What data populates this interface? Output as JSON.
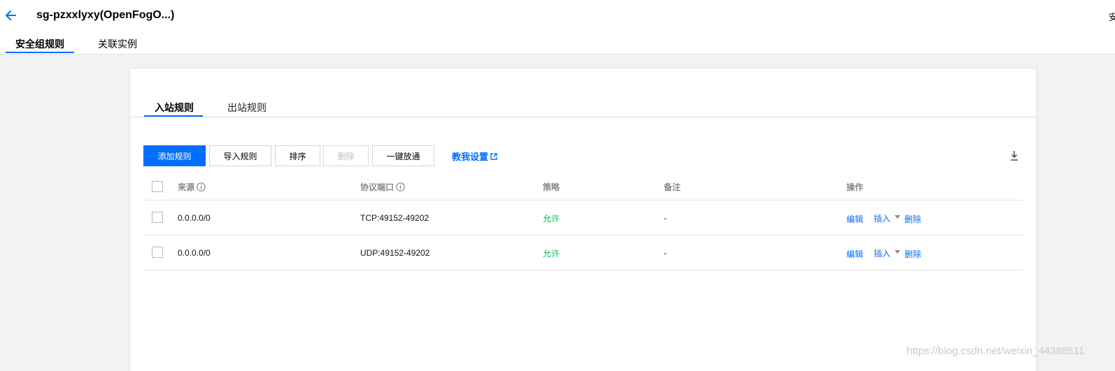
{
  "header": {
    "title": "sg-pzxxlyxy(OpenFogO...)",
    "corner_text": "安",
    "tabs": [
      {
        "label": "安全组规则",
        "active": true
      },
      {
        "label": "关联实例",
        "active": false
      }
    ]
  },
  "rules": {
    "tabs": [
      {
        "label": "入站规则",
        "active": true
      },
      {
        "label": "出站规则",
        "active": false
      }
    ],
    "toolbar": {
      "add_label": "添加规则",
      "import_label": "导入规则",
      "sort_label": "排序",
      "delete_label": "删除",
      "open_all_label": "一键放通",
      "help_label": "教我设置"
    },
    "table": {
      "columns": [
        "来源",
        "协议端口",
        "策略",
        "备注",
        "操作"
      ],
      "rows": [
        {
          "source": "0.0.0.0/0",
          "port": "TCP:49152-49202",
          "policy": "允许",
          "note": "-",
          "actions": [
            "编辑",
            "插入",
            "删除"
          ]
        },
        {
          "source": "0.0.0.0/0",
          "port": "UDP:49152-49202",
          "policy": "允许",
          "note": "-",
          "actions": [
            "编辑",
            "插入",
            "删除"
          ]
        }
      ]
    }
  },
  "watermark": "https://blog.csdn.net/weixin_44388511",
  "colors": {
    "accent": "#006eff",
    "allow": "#0abf5b",
    "page_background": "#f2f2f2"
  },
  "icons": [
    "back-arrow-icon",
    "info-icon",
    "external-link-icon",
    "download-icon",
    "dropdown-caret-icon"
  ]
}
